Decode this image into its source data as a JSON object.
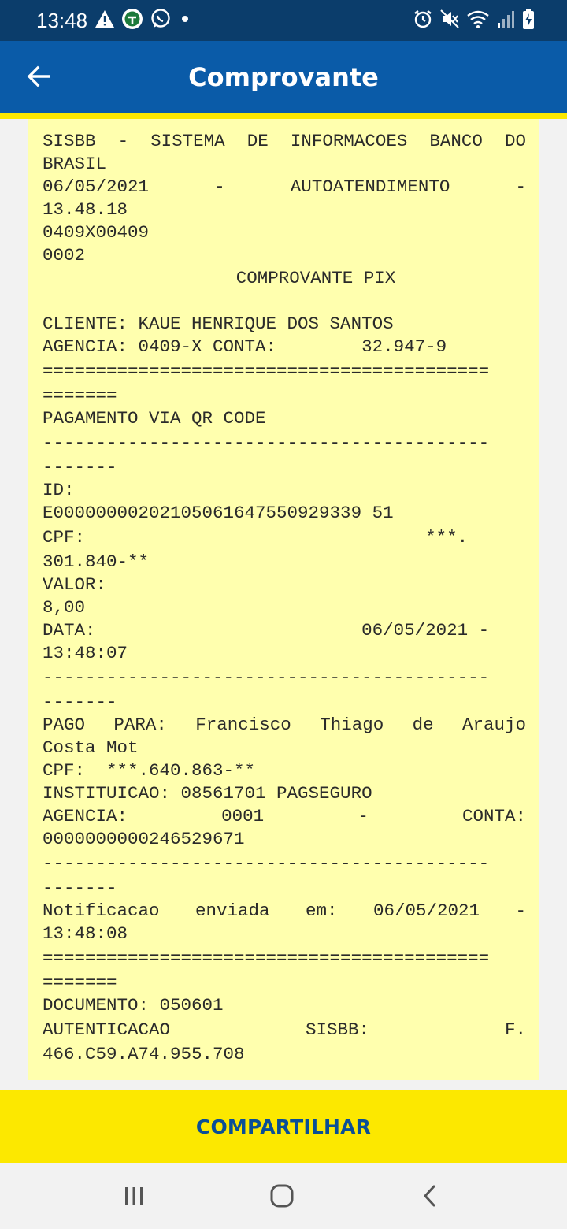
{
  "status_bar": {
    "time": "13:48",
    "left_icons": [
      "warning-icon",
      "app-notification-icon",
      "whatsapp-icon",
      "dot-icon"
    ],
    "right_icons": [
      "alarm-icon",
      "mute-icon",
      "wifi-icon",
      "signal-icon",
      "battery-charging-icon"
    ]
  },
  "app_bar": {
    "title": "Comprovante",
    "back_icon": "arrow-left-icon",
    "background": "#0a5ba8",
    "accent": "#fce800"
  },
  "receipt": {
    "background": "#ffffae",
    "lines": [
      "SISBB - SISTEMA DE INFORMACOES BANCO DO",
      "BRASIL",
      "06/05/2021 - AUTOATENDIMENTO -",
      "13.48.18",
      "0409X00409",
      "0002",
      "COMPROVANTE PIX",
      "",
      "CLIENTE: KAUE HENRIQUE DOS SANTOS",
      "AGENCIA: 0409-X CONTA:        32.947-9",
      "==========================================",
      "=======",
      "PAGAMENTO VIA QR CODE",
      "------------------------------------------",
      "-------",
      "ID:",
      "E00000000202105061647550929339 51",
      "CPF:                                ***.",
      "301.840-**",
      "VALOR:",
      "8,00",
      "DATA:                         06/05/2021 -",
      "13:48:07",
      "------------------------------------------",
      "-------",
      "PAGO PARA: Francisco Thiago de Araujo",
      "Costa Mot",
      "CPF:  ***.640.863-**",
      "INSTITUICAO: 08561701 PAGSEGURO",
      "AGENCIA: 0001 - CONTA:",
      "0000000000246529671",
      "------------------------------------------",
      "-------",
      "Notificacao enviada em: 06/05/2021 -",
      "13:48:08",
      "==========================================",
      "=======",
      "DOCUMENTO: 050601",
      "AUTENTICACAO SISBB: F.",
      "466.C59.A74.955.708"
    ]
  },
  "footer": {
    "share_label": "COMPARTILHAR",
    "background": "#fce800"
  },
  "nav_bar": {
    "icons": [
      "recent-apps-icon",
      "home-icon",
      "back-icon"
    ]
  }
}
